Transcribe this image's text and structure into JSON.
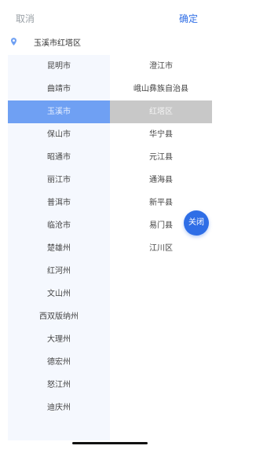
{
  "header": {
    "cancel_label": "取消",
    "confirm_label": "确定"
  },
  "location": {
    "current": "玉溪市红塔区"
  },
  "cities": [
    {
      "label": "昆明市"
    },
    {
      "label": "曲靖市"
    },
    {
      "label": "玉溪市"
    },
    {
      "label": "保山市"
    },
    {
      "label": "昭通市"
    },
    {
      "label": "丽江市"
    },
    {
      "label": "普洱市"
    },
    {
      "label": "临沧市"
    },
    {
      "label": "楚雄州"
    },
    {
      "label": "红河州"
    },
    {
      "label": "文山州"
    },
    {
      "label": "西双版纳州"
    },
    {
      "label": "大理州"
    },
    {
      "label": "德宏州"
    },
    {
      "label": "怒江州"
    },
    {
      "label": "迪庆州"
    }
  ],
  "districts": [
    {
      "label": "澄江市"
    },
    {
      "label": "峨山彝族自治县"
    },
    {
      "label": "红塔区"
    },
    {
      "label": "华宁县"
    },
    {
      "label": "元江县"
    },
    {
      "label": "通海县"
    },
    {
      "label": "新平县"
    },
    {
      "label": "易门县"
    },
    {
      "label": "江川区"
    }
  ],
  "selected_city": "玉溪市",
  "selected_district": "红塔区",
  "close_button_label": "关闭",
  "colors": {
    "accent": "#2f6ee6",
    "selected_city_bg": "#6fa0f3",
    "selected_district_bg": "#c8c8c8",
    "left_panel_bg": "#f5f8fe"
  },
  "icons": {
    "location": "location-pin-icon"
  }
}
